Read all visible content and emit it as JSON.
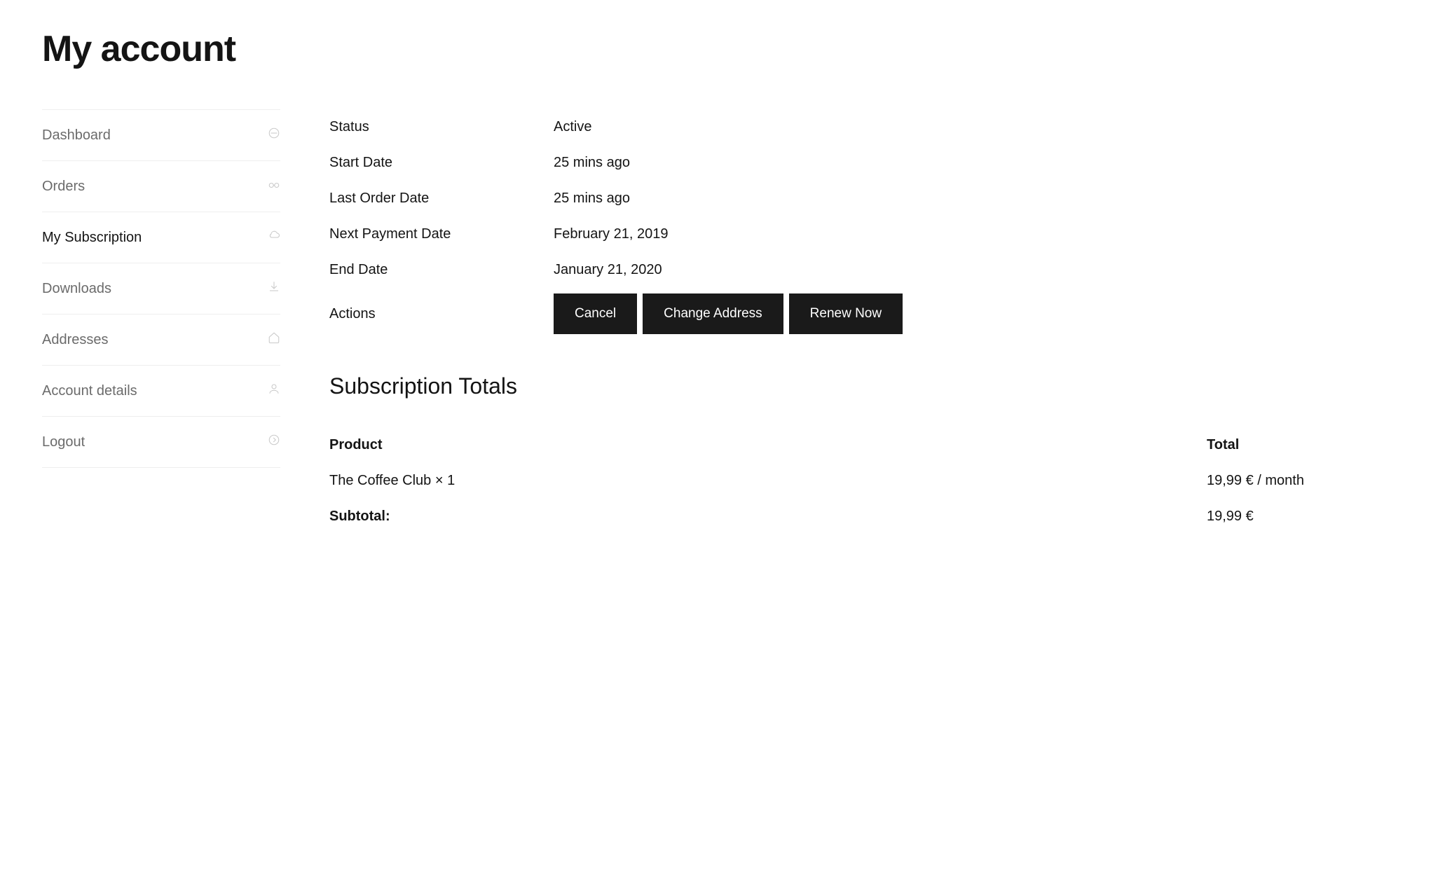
{
  "pageTitle": "My account",
  "sidebar": {
    "items": [
      {
        "label": "Dashboard",
        "icon": "gauge-icon",
        "active": false
      },
      {
        "label": "Orders",
        "icon": "glasses-icon",
        "active": false
      },
      {
        "label": "My Subscription",
        "icon": "cloud-icon",
        "active": true
      },
      {
        "label": "Downloads",
        "icon": "download-icon",
        "active": false
      },
      {
        "label": "Addresses",
        "icon": "home-icon",
        "active": false
      },
      {
        "label": "Account details",
        "icon": "person-icon",
        "active": false
      },
      {
        "label": "Logout",
        "icon": "arrow-right-circle-icon",
        "active": false
      }
    ]
  },
  "details": {
    "statusLabel": "Status",
    "statusValue": "Active",
    "startDateLabel": "Start Date",
    "startDateValue": "25 mins ago",
    "lastOrderLabel": "Last Order Date",
    "lastOrderValue": "25 mins ago",
    "nextPaymentLabel": "Next Payment Date",
    "nextPaymentValue": "February 21, 2019",
    "endDateLabel": "End Date",
    "endDateValue": "January 21, 2020",
    "actionsLabel": "Actions"
  },
  "actions": {
    "cancel": "Cancel",
    "changeAddress": "Change Address",
    "renewNow": "Renew Now"
  },
  "totals": {
    "heading": "Subscription Totals",
    "productHeader": "Product",
    "totalHeader": "Total",
    "productName": "The Coffee Club × 1",
    "productTotal": "19,99 € / month",
    "subtotalLabel": "Subtotal:",
    "subtotalValue": "19,99 €"
  }
}
